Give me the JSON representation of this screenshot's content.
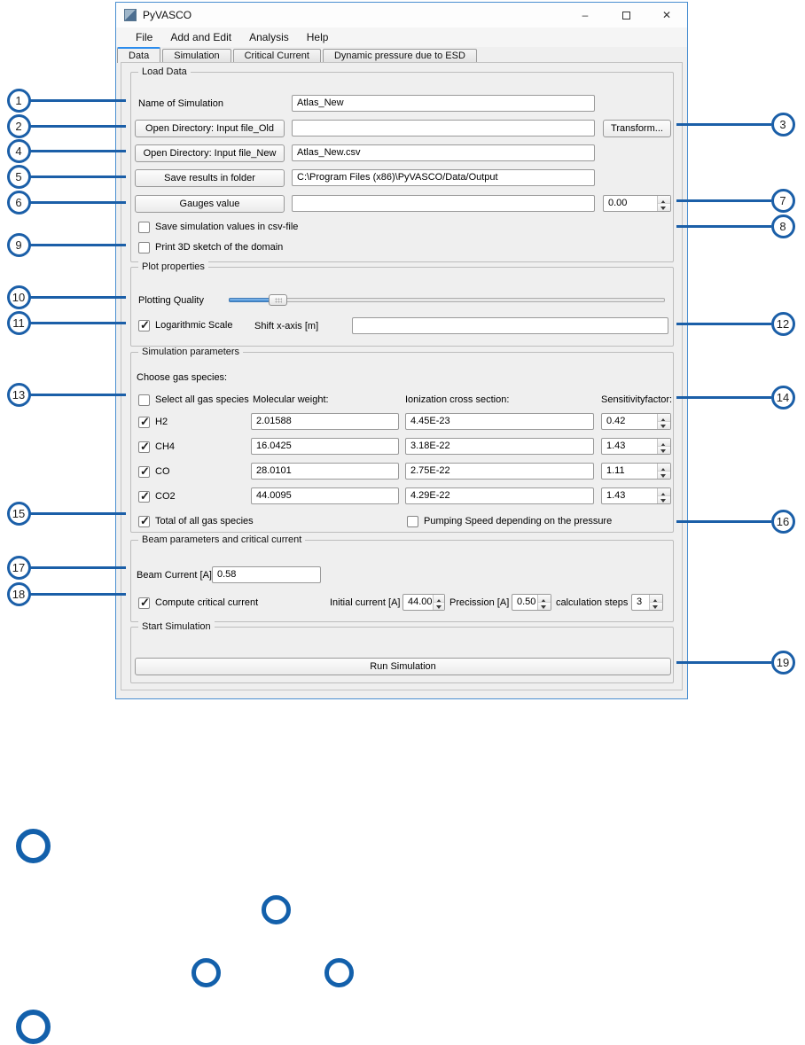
{
  "window": {
    "title": "PyVASCO",
    "minimize": "–",
    "close": "✕",
    "menu": [
      "File",
      "Add and Edit",
      "Analysis",
      "Help"
    ],
    "tabs": [
      "Data",
      "Simulation",
      "Critical Current",
      "Dynamic pressure due to ESD"
    ],
    "selected_tab": "Data"
  },
  "load_data": {
    "legend": "Load Data",
    "name_label": "Name of Simulation",
    "name_value": "Atlas_New",
    "btn_old": "Open Directory: Input file_Old",
    "old_value": "",
    "transform_btn": "Transform...",
    "btn_new": "Open Directory: Input file_New",
    "new_value": "Atlas_New.csv",
    "btn_save": "Save results in folder",
    "save_value": "C:\\Program Files (x86)\\PyVASCO/Data/Output",
    "btn_gauges": "Gauges value",
    "gauges_value": "",
    "gauges_spin": "0.00",
    "chk_csv": "Save simulation values in csv-file",
    "chk_csv_checked": false,
    "chk_sketch": "Print 3D sketch of the domain",
    "chk_sketch_checked": false
  },
  "plot": {
    "legend": "Plot properties",
    "quality_label": "Plotting Quality",
    "log_label": "Logarithmic Scale",
    "log_checked": true,
    "shift_label": "Shift x-axis [m]",
    "shift_value": ""
  },
  "sim": {
    "legend": "Simulation parameters",
    "choose_label": "Choose gas species:",
    "select_all": "Select all gas species",
    "select_all_checked": false,
    "col_mw": "Molecular weight:",
    "col_ion": "Ionization cross section:",
    "col_sens": "Sensitivityfactor:",
    "rows": [
      {
        "gas": "H2",
        "checked": true,
        "mw": "2.01588",
        "ion": "4.45E-23",
        "sens": "0.42"
      },
      {
        "gas": "CH4",
        "checked": true,
        "mw": "16.0425",
        "ion": "3.18E-22",
        "sens": "1.43"
      },
      {
        "gas": "CO",
        "checked": true,
        "mw": "28.0101",
        "ion": "2.75E-22",
        "sens": "1.11"
      },
      {
        "gas": "CO2",
        "checked": true,
        "mw": "44.0095",
        "ion": "4.29E-22",
        "sens": "1.43"
      }
    ],
    "total_label": "Total of all gas species",
    "total_checked": true,
    "pumping_label": "Pumping Speed depending on the pressure",
    "pumping_checked": false
  },
  "beam": {
    "legend": "Beam parameters and critical current",
    "current_label": "Beam Current [A]",
    "current_value": "0.58",
    "compute_label": "Compute critical current",
    "compute_checked": true,
    "initial_label": "Initial current [A]",
    "initial_value": "44.00",
    "precission_label": "Precission [A]",
    "precission_value": "0.50",
    "steps_label": "calculation steps",
    "steps_value": "3"
  },
  "start": {
    "legend": "Start Simulation",
    "run_label": "Run Simulation"
  },
  "callouts": {
    "numbers": [
      "1",
      "2",
      "3",
      "4",
      "5",
      "6",
      "7",
      "8",
      "9",
      "10",
      "11",
      "12",
      "13",
      "14",
      "15",
      "16",
      "17",
      "18",
      "19"
    ]
  },
  "colors": {
    "callout_blue": "#1b5fa8",
    "window_border": "#4a8fd1",
    "tab_accent": "#2b8ced",
    "content_bg": "#efefef"
  }
}
